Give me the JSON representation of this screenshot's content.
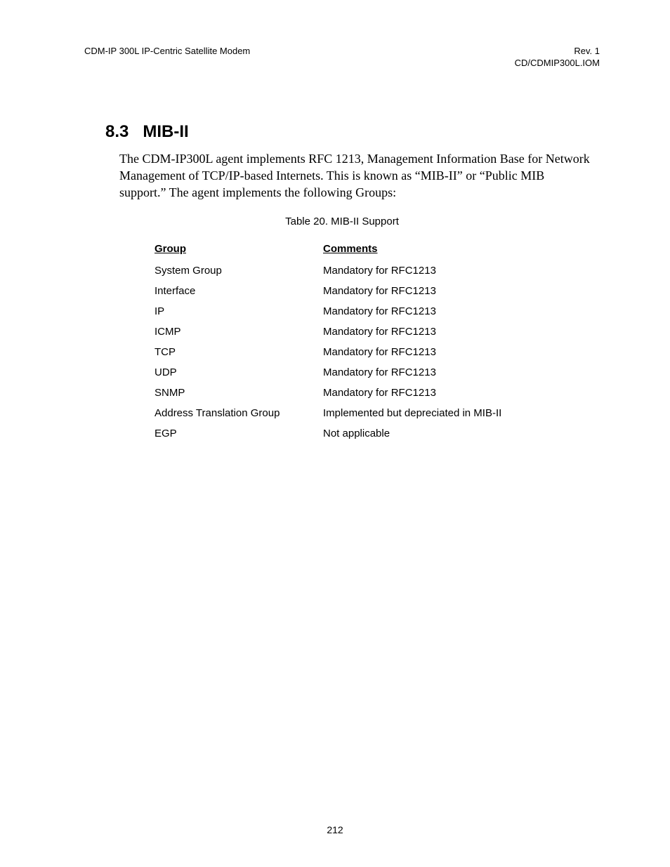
{
  "header": {
    "left": "CDM-IP 300L IP-Centric Satellite Modem",
    "right_line1": "Rev. 1",
    "right_line2": "CD/CDMIP300L.IOM"
  },
  "section": {
    "number": "8.3",
    "title": "MIB-II"
  },
  "body_paragraph": "The CDM-IP300L agent implements RFC 1213, Management Information Base for Network Management of TCP/IP-based Internets. This is known as “MIB-II” or “Public MIB support.” The agent implements the following Groups:",
  "table": {
    "caption": "Table 20. MIB-II Support",
    "headers": {
      "group": "Group",
      "comments": "Comments"
    },
    "rows": [
      {
        "group": "System Group",
        "comments": "Mandatory for RFC1213"
      },
      {
        "group": "Interface",
        "comments": "Mandatory for RFC1213"
      },
      {
        "group": "IP",
        "comments": "Mandatory for RFC1213"
      },
      {
        "group": "ICMP",
        "comments": "Mandatory for RFC1213"
      },
      {
        "group": "TCP",
        "comments": "Mandatory for RFC1213"
      },
      {
        "group": "UDP",
        "comments": "Mandatory for RFC1213"
      },
      {
        "group": "SNMP",
        "comments": "Mandatory for RFC1213"
      },
      {
        "group": "Address Translation Group",
        "comments": "Implemented but depreciated in MIB-II"
      },
      {
        "group": "EGP",
        "comments": "Not applicable"
      }
    ]
  },
  "page_number": "212"
}
